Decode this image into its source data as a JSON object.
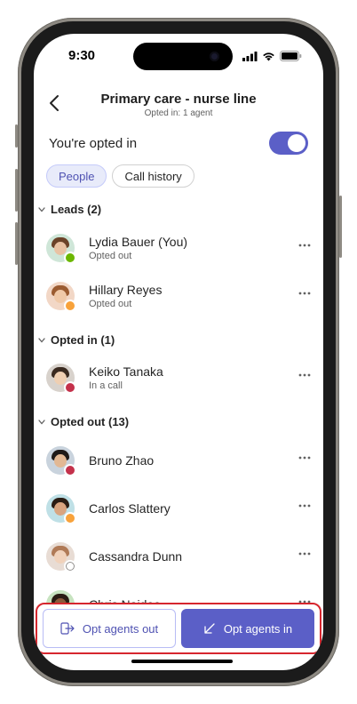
{
  "status_bar": {
    "time": "9:30"
  },
  "header": {
    "title": "Primary care - nurse line",
    "subtitle": "Opted in: 1 agent"
  },
  "opt_in": {
    "label": "You're opted in",
    "enabled": true
  },
  "tabs": [
    {
      "label": "People",
      "active": true
    },
    {
      "label": "Call history",
      "active": false
    }
  ],
  "sections": {
    "leads": "Leads (2)",
    "opted_in": "Opted in (1)",
    "opted_out": "Opted out (13)"
  },
  "people": {
    "lydia": {
      "name": "Lydia Bauer (You)",
      "status": "Opted out",
      "presence": "available"
    },
    "hillary": {
      "name": "Hillary Reyes",
      "status": "Opted out",
      "presence": "away"
    },
    "keiko": {
      "name": "Keiko Tanaka",
      "status": "In a call",
      "presence": "busy"
    },
    "bruno": {
      "name": "Bruno Zhao",
      "presence": "busy"
    },
    "carlos": {
      "name": "Carlos Slattery",
      "presence": "away"
    },
    "cassandra": {
      "name": "Cassandra Dunn",
      "presence": "offline"
    },
    "chris": {
      "name": "Chris Naidoo",
      "presence": "available"
    }
  },
  "actions": {
    "opt_out_label": "Opt agents out",
    "opt_in_label": "Opt agents in"
  },
  "colors": {
    "brand": "#5b5fc7",
    "available": "#6bb700",
    "away": "#f8a23b",
    "busy": "#c4314b",
    "highlight": "#d6262e"
  }
}
